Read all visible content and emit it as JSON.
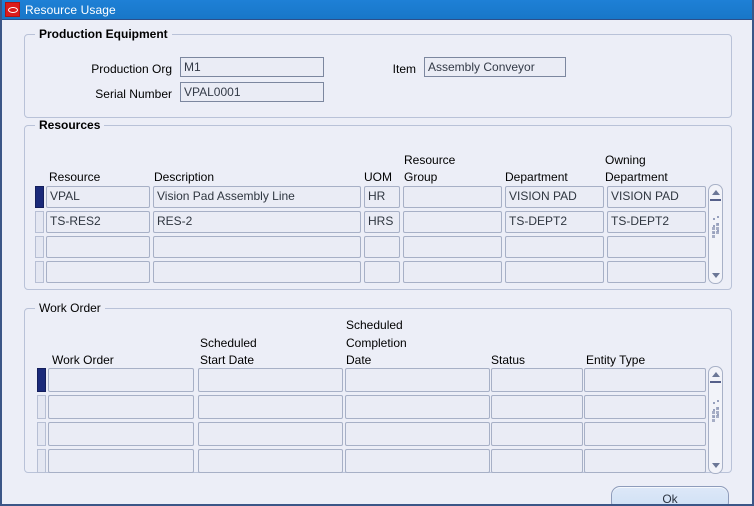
{
  "window": {
    "title": "Resource Usage",
    "icon": "oracle-logo-icon",
    "accent_titlebar": "#1d7fd4",
    "frame_border": "#3b5687",
    "background": "#eceef7"
  },
  "production_equipment": {
    "legend": "Production Equipment",
    "fields": [
      {
        "label": "Production Org",
        "value": "M1"
      },
      {
        "label": "Serial Number",
        "value": "VPAL0001"
      },
      {
        "label": "Item",
        "value": "Assembly Conveyor"
      }
    ]
  },
  "resources": {
    "legend": "Resources",
    "columns": [
      "Resource",
      "Description",
      "UOM",
      "Resource Group",
      "Department",
      "Owning Department"
    ],
    "column_lines": {
      "resource": [
        "Resource"
      ],
      "description": [
        "Description"
      ],
      "uom": [
        "UOM"
      ],
      "resource_group": [
        "Resource",
        "Group"
      ],
      "department": [
        "Department"
      ],
      "owning_department": [
        "Owning",
        "Department"
      ]
    },
    "rows": [
      {
        "selected": true,
        "resource": "VPAL",
        "description": "Vision Pad Assembly Line",
        "uom": "HR",
        "resource_group": "",
        "department": "VISION PAD",
        "owning_department": "VISION PAD"
      },
      {
        "selected": false,
        "resource": "TS-RES2",
        "description": "RES-2",
        "uom": "HRS",
        "resource_group": "",
        "department": "TS-DEPT2",
        "owning_department": "TS-DEPT2"
      },
      {
        "selected": false,
        "resource": "",
        "description": "",
        "uom": "",
        "resource_group": "",
        "department": "",
        "owning_department": ""
      },
      {
        "selected": false,
        "resource": "",
        "description": "",
        "uom": "",
        "resource_group": "",
        "department": "",
        "owning_department": ""
      }
    ]
  },
  "work_order": {
    "legend": "Work Order",
    "columns": [
      "Work Order",
      "Scheduled Start Date",
      "Scheduled Completion Date",
      "Status",
      "Entity Type"
    ],
    "column_lines": {
      "work_order": [
        "Work Order"
      ],
      "scheduled_start_date": [
        "Scheduled",
        "Start Date"
      ],
      "scheduled_completion_date": [
        "Scheduled",
        "Completion",
        "Date"
      ],
      "status": [
        "Status"
      ],
      "entity_type": [
        "Entity Type"
      ]
    },
    "rows": [
      {
        "selected": true,
        "work_order": "",
        "scheduled_start_date": "",
        "scheduled_completion_date": "",
        "status": "",
        "entity_type": ""
      },
      {
        "selected": false,
        "work_order": "",
        "scheduled_start_date": "",
        "scheduled_completion_date": "",
        "status": "",
        "entity_type": ""
      },
      {
        "selected": false,
        "work_order": "",
        "scheduled_start_date": "",
        "scheduled_completion_date": "",
        "status": "",
        "entity_type": ""
      },
      {
        "selected": false,
        "work_order": "",
        "scheduled_start_date": "",
        "scheduled_completion_date": "",
        "status": "",
        "entity_type": ""
      }
    ]
  },
  "footer": {
    "ok_label": "Ok"
  }
}
